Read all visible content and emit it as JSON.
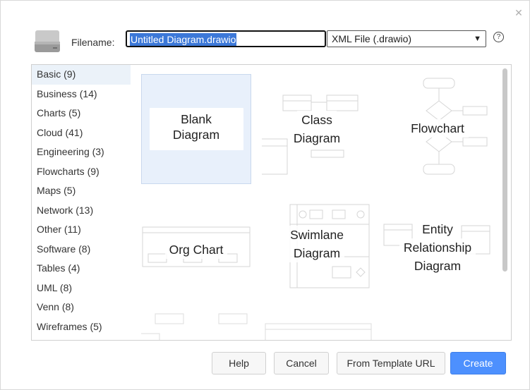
{
  "dialog": {
    "close_icon": "close-icon"
  },
  "header": {
    "filename_label": "Filename:",
    "filename_value": "Untitled Diagram.drawio",
    "format_selected": "XML File (.drawio)",
    "help_icon": "?"
  },
  "categories": [
    {
      "label": "Basic (9)",
      "selected": true
    },
    {
      "label": "Business (14)"
    },
    {
      "label": "Charts (5)"
    },
    {
      "label": "Cloud (41)"
    },
    {
      "label": "Engineering (3)"
    },
    {
      "label": "Flowcharts (9)"
    },
    {
      "label": "Maps (5)"
    },
    {
      "label": "Network (13)"
    },
    {
      "label": "Other (11)"
    },
    {
      "label": "Software (8)"
    },
    {
      "label": "Tables (4)"
    },
    {
      "label": "UML (8)"
    },
    {
      "label": "Venn (8)"
    },
    {
      "label": "Wireframes (5)"
    }
  ],
  "templates": [
    {
      "line1": "Blank",
      "line2": "Diagram"
    },
    {
      "line1": "Class",
      "line2": "Diagram"
    },
    {
      "line1": "Flowchart"
    },
    {
      "line1": "Org Chart"
    },
    {
      "line1": "Swimlane",
      "line2": "Diagram"
    },
    {
      "line1": "Entity",
      "line2": "Relationship",
      "line3": "Diagram"
    }
  ],
  "footer": {
    "help_label": "Help",
    "cancel_label": "Cancel",
    "template_url_label": "From Template URL",
    "create_label": "Create"
  },
  "colors": {
    "accent": "#4d90fe",
    "selection": "#3c78d8",
    "tile_selected": "#e8f0fb"
  }
}
